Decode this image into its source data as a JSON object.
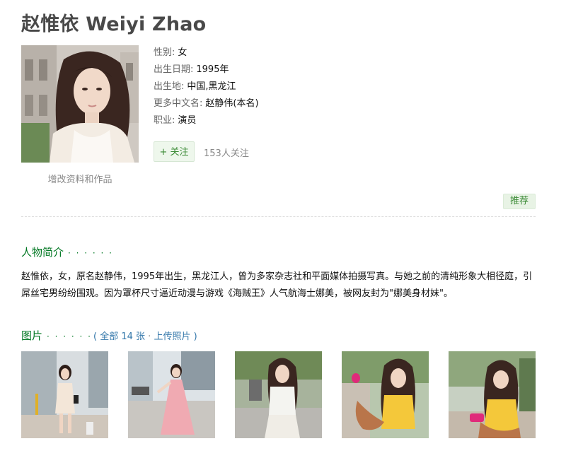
{
  "celebrity": {
    "name": "赵惟依 Weiyi Zhao",
    "edit_label": "增改资料和作品"
  },
  "info": [
    {
      "key": "性别:",
      "value": "女"
    },
    {
      "key": "出生日期:",
      "value": "1995年"
    },
    {
      "key": "出生地:",
      "value": "中国,黑龙江"
    },
    {
      "key": "更多中文名:",
      "value": "赵静伟(本名)"
    },
    {
      "key": "职业:",
      "value": "演员"
    }
  ],
  "follow": {
    "button_label": "+ 关注",
    "count_text": "153人关注"
  },
  "recommend_label": "推荐",
  "bio": {
    "heading": "人物简介",
    "dots": "· · · · · ·",
    "text": "赵惟依，女，原名赵静伟，1995年出生，黑龙江人，曾为多家杂志社和平面媒体拍摄写真。与她之前的清纯形象大相径庭，引屌丝宅男纷纷围观。因为罩杯尺寸逼近动漫与游戏《海贼王》人气航海士娜美，被网友封为\"娜美身材妹\"。"
  },
  "photos": {
    "heading": "图片",
    "dots": "· · · · · ·",
    "open_paren": "(",
    "all_label": "全部 14 张",
    "separator": "·",
    "upload_label": "上传照片",
    "close_paren": ")",
    "count_shown": 5
  },
  "colors": {
    "accent_green": "#007722",
    "link_blue": "#3377aa",
    "button_green_bg": "#eef7ec"
  }
}
